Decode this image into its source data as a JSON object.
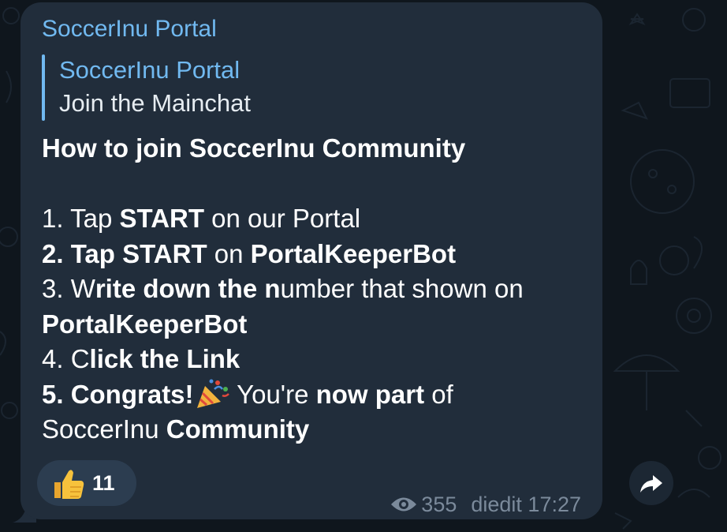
{
  "message": {
    "sender": "SoccerInu Portal",
    "reply": {
      "title": "SoccerInu Portal",
      "text": "Join the Mainchat"
    },
    "heading": "How to join SoccerInu Community",
    "steps": {
      "s1_a": "1. Tap ",
      "s1_b": "START",
      "s1_c": " on our Portal",
      "s2_a": "2. Tap START",
      "s2_b": " on ",
      "s2_c": "PortalKeeperBot",
      "s3_a": "3. W",
      "s3_b": "rite down the n",
      "s3_c": "umber that shown on",
      "s3_d": "PortalKeeperBot",
      "s4_a": "4. C",
      "s4_b": "lick the Link",
      "s5_a": "5. Congrats!",
      "s5_b": " You're ",
      "s5_c": "now part",
      "s5_d": " of",
      "s5_e": "SoccerInu ",
      "s5_f": "Community"
    },
    "reaction": {
      "emoji": "thumbs-up",
      "count": "11"
    },
    "views": "355",
    "edited_label": "diedit",
    "time": "17:27"
  },
  "colors": {
    "bubble": "#212d3b",
    "accent": "#71b9f0",
    "meta": "#7b8a9b",
    "background": "#0f161d"
  },
  "icons": [
    "party-popper-icon",
    "thumbs-up-icon",
    "eye-icon",
    "share-arrow-icon"
  ]
}
